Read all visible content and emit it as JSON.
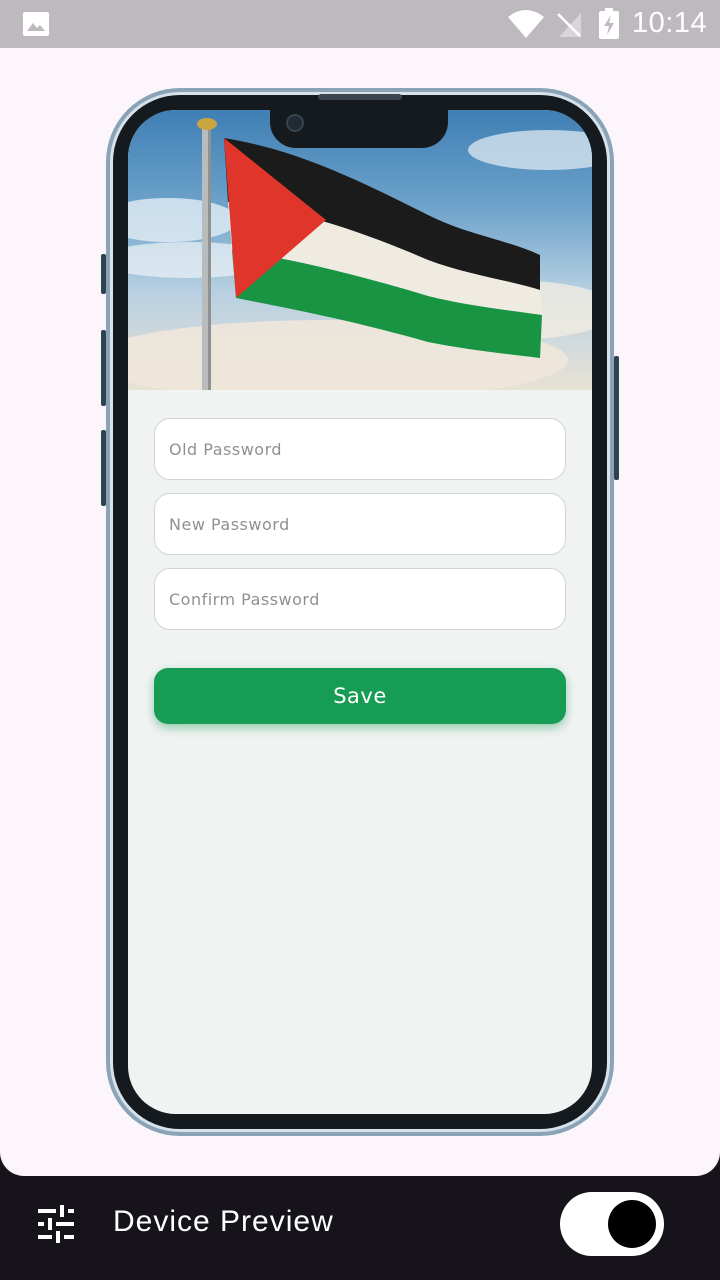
{
  "status_bar": {
    "time": "10:14",
    "icons": [
      "photo-icon",
      "wifi-icon",
      "no-signal-icon",
      "battery-charging-icon"
    ]
  },
  "preview": {
    "hero_image": "palestine-flag-photo",
    "form": {
      "old_password_placeholder": "Old Password",
      "new_password_placeholder": "New Password",
      "confirm_password_placeholder": "Confirm Password",
      "save_label": "Save"
    },
    "colors": {
      "accent": "#169c54",
      "screen_bg": "#f1f3f3"
    }
  },
  "bottom_bar": {
    "title": "Device Preview",
    "settings_icon": "tune-icon",
    "toggle_on": true
  }
}
